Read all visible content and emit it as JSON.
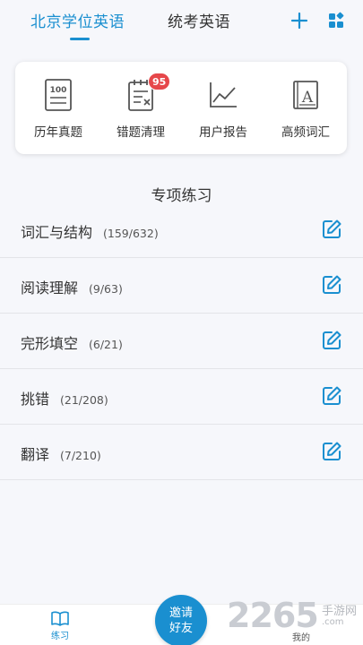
{
  "header": {
    "tabs": [
      {
        "label": "北京学位英语",
        "active": true
      },
      {
        "label": "统考英语",
        "active": false
      }
    ],
    "add_icon": "plus-icon",
    "apps_icon": "grid-icon"
  },
  "shortcuts": [
    {
      "label": "历年真题",
      "icon": "exam-paper-icon",
      "icon_text": "100"
    },
    {
      "label": "错题清理",
      "icon": "wrong-questions-icon",
      "badge": "95"
    },
    {
      "label": "用户报告",
      "icon": "line-chart-icon"
    },
    {
      "label": "高频词汇",
      "icon": "vocabulary-book-icon",
      "icon_text": "A"
    }
  ],
  "section": {
    "title": "专项练习",
    "items": [
      {
        "name": "词汇与结构",
        "count": "(159/632)"
      },
      {
        "name": "阅读理解",
        "count": "(9/63)"
      },
      {
        "name": "完形填空",
        "count": "(6/21)"
      },
      {
        "name": "挑错",
        "count": "(21/208)"
      },
      {
        "name": "翻译",
        "count": "(7/210)"
      }
    ]
  },
  "bottom_nav": {
    "practice": "练习",
    "invite": [
      "邀请",
      "好友"
    ],
    "mine": "我的"
  },
  "watermark": {
    "number": "2265",
    "site_line1": "手游网",
    "site_line2": ".com"
  },
  "colors": {
    "accent": "#1a8fd0",
    "badge": "#e6474a"
  }
}
